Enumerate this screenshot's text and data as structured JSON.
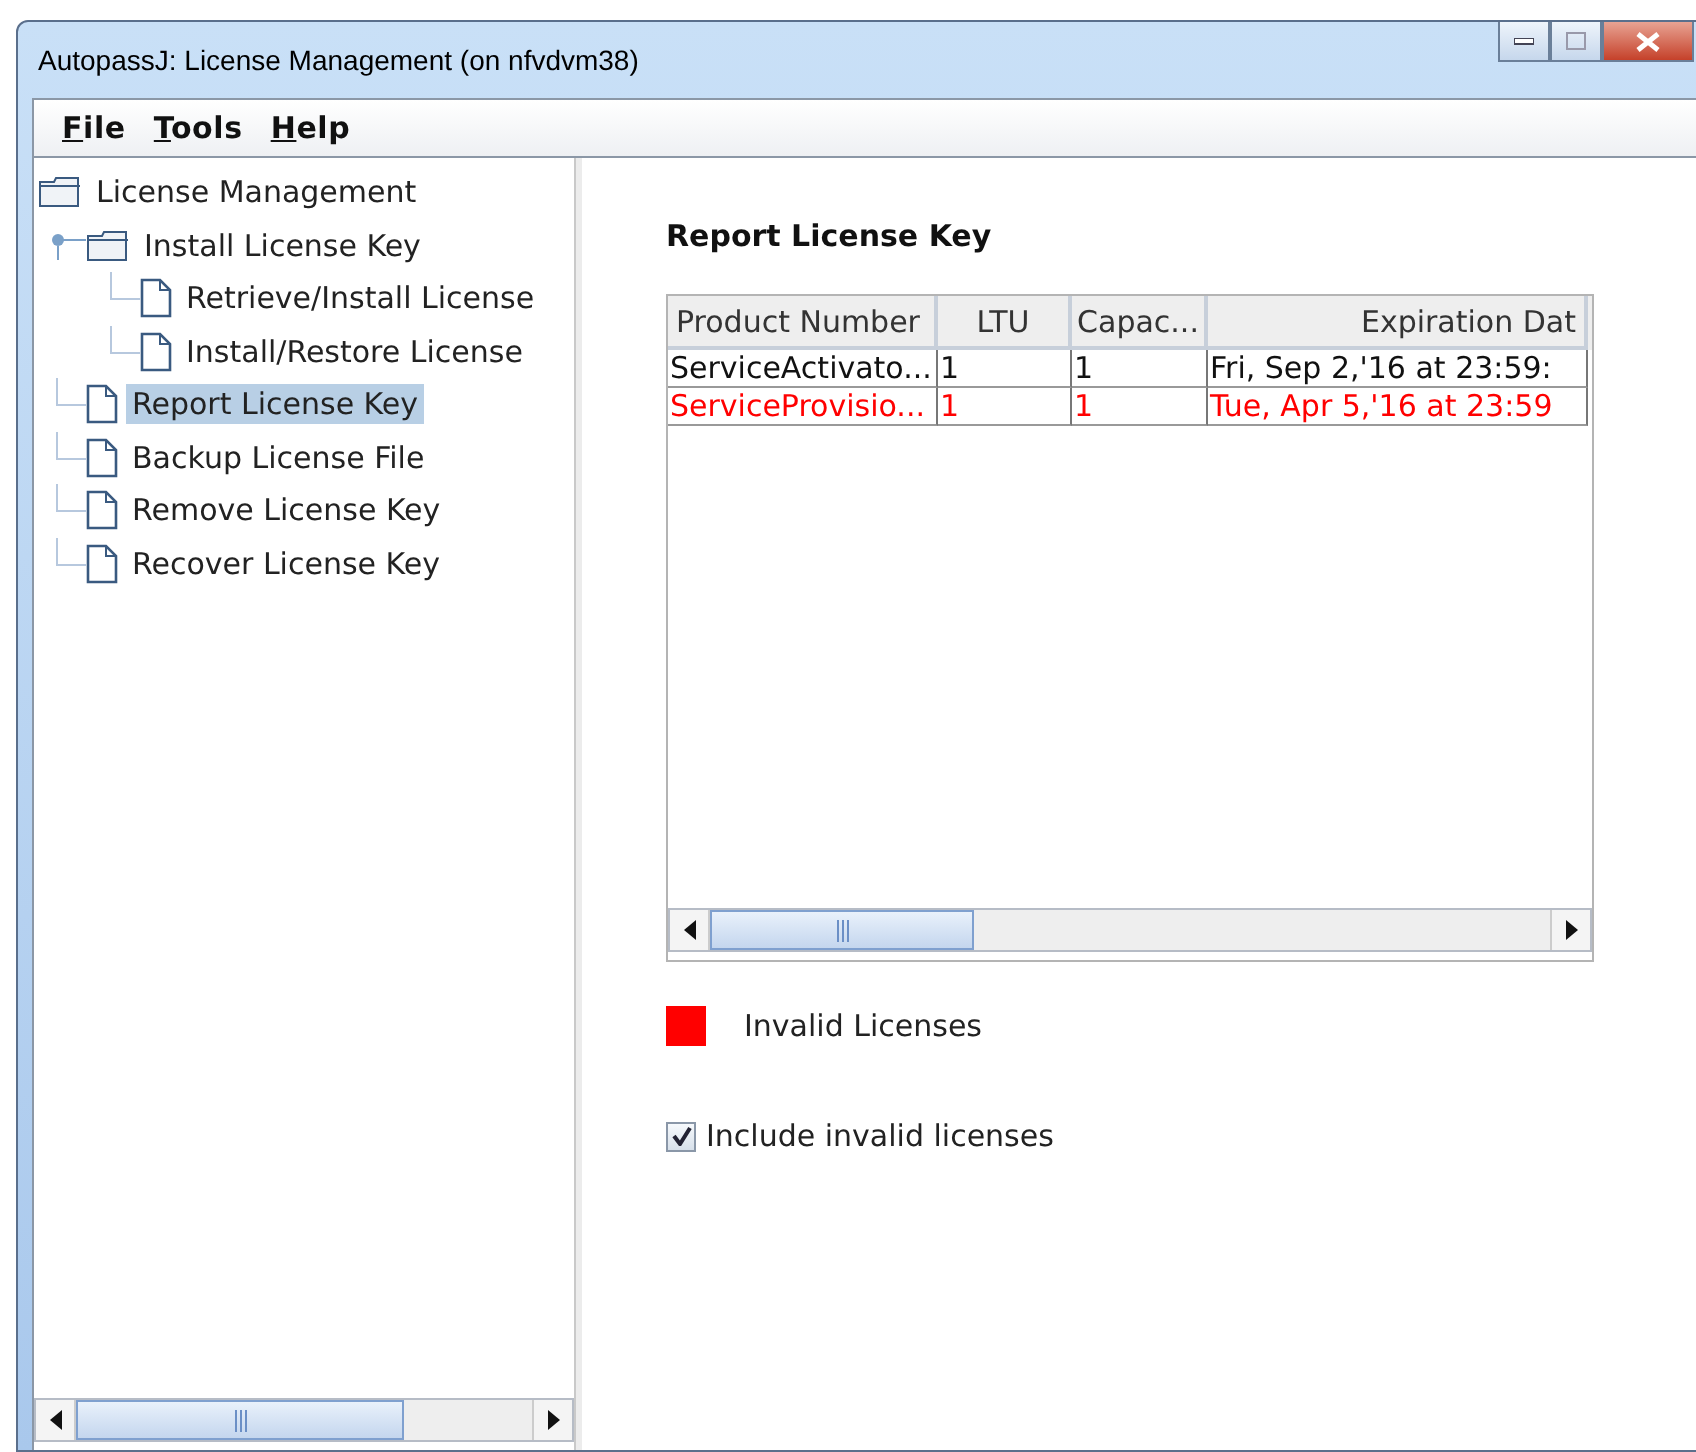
{
  "window": {
    "title": "AutopassJ: License Management (on nfvdvm38)"
  },
  "menu": [
    {
      "label": "File"
    },
    {
      "label": "Tools"
    },
    {
      "label": "Help"
    }
  ],
  "tree": {
    "label": "License Management",
    "kind": "folder",
    "selected": false,
    "children": [
      {
        "label": "Install License Key",
        "kind": "folder",
        "selected": false,
        "expanded": true,
        "children": [
          {
            "label": "Retrieve/Install License",
            "kind": "leaf",
            "selected": false
          },
          {
            "label": "Install/Restore License",
            "kind": "leaf",
            "selected": false
          }
        ]
      },
      {
        "label": "Report License Key",
        "kind": "leaf",
        "selected": true
      },
      {
        "label": "Backup License File",
        "kind": "leaf",
        "selected": false
      },
      {
        "label": "Remove License Key",
        "kind": "leaf",
        "selected": false
      },
      {
        "label": "Recover License Key",
        "kind": "leaf",
        "selected": false
      }
    ]
  },
  "report": {
    "title": "Report License Key",
    "table": {
      "columns": [
        "Product Number",
        "LTU",
        "Capac...",
        "Expiration Dat"
      ],
      "rows": [
        {
          "cells": [
            "ServiceActivato...",
            "1",
            "1",
            "Fri, Sep 2,'16 at 23:59:"
          ],
          "invalid": false
        },
        {
          "cells": [
            "ServiceProvisio...",
            "1",
            "1",
            "Tue, Apr 5,'16 at 23:59"
          ],
          "invalid": true
        }
      ]
    },
    "legend": {
      "label": "Invalid Licenses",
      "color": "#ff0000"
    },
    "include_invalid": {
      "label": "Include invalid licenses",
      "checked": true
    }
  }
}
